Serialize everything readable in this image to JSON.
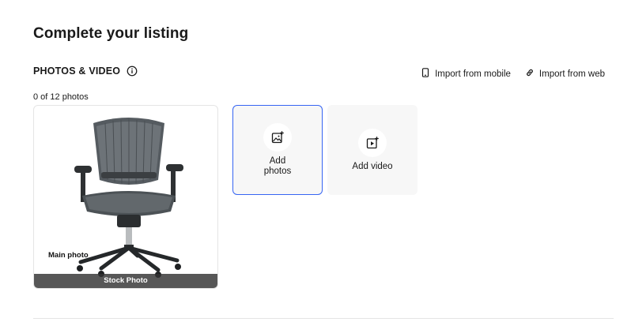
{
  "page": {
    "title": "Complete your listing"
  },
  "photos_section": {
    "title": "PHOTOS & VIDEO",
    "info_icon": "info-icon",
    "photo_count": "0 of 12 photos",
    "import_links": [
      {
        "label": "Import from mobile",
        "icon": "mobile-phone-icon"
      },
      {
        "label": "Import from web",
        "icon": "link-icon"
      }
    ],
    "main_photo": {
      "label": "Main photo",
      "badge": "Stock Photo"
    },
    "add_photos_label": "Add photos",
    "add_video_label": "Add video"
  },
  "colors": {
    "accent_border": "#3665f3",
    "tile_background": "#f7f7f7",
    "stock_bar": "#323232"
  }
}
